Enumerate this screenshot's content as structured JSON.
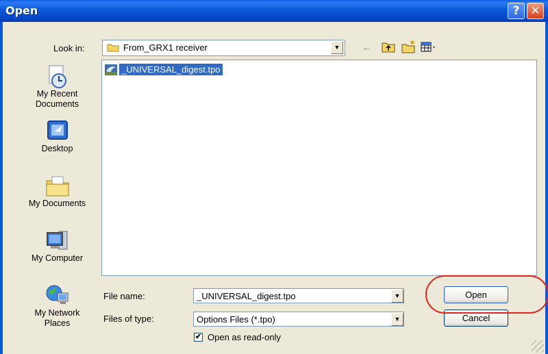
{
  "window": {
    "title": "Open",
    "help_glyph": "?",
    "close_glyph": "✕"
  },
  "toolbar": {
    "look_in_label": "Look in:",
    "look_in_value": "From_GRX1 receiver",
    "icons": [
      "back-arrow-icon",
      "up-folder-icon",
      "new-folder-icon",
      "views-menu-icon"
    ]
  },
  "places": [
    {
      "label": "My Recent Documents",
      "icon": "recent-documents-icon"
    },
    {
      "label": "Desktop",
      "icon": "desktop-icon"
    },
    {
      "label": "My Documents",
      "icon": "my-documents-icon"
    },
    {
      "label": "My Computer",
      "icon": "my-computer-icon"
    },
    {
      "label": "My Network Places",
      "icon": "network-places-icon"
    }
  ],
  "files": [
    {
      "name": "_UNIVERSAL_digest.tpo",
      "selected": true
    }
  ],
  "form": {
    "file_name_label": "File name:",
    "file_name_value": "_UNIVERSAL_digest.tpo",
    "file_type_label": "Files of type:",
    "file_type_value": "Options Files (*.tpo)",
    "readonly_label": "Open as read-only",
    "readonly_checked": true
  },
  "buttons": {
    "open": "Open",
    "cancel": "Cancel"
  },
  "colors": {
    "titlebar": "#0a58d8",
    "selection": "#316ac5",
    "annotation": "#e2231a",
    "dialog_bg": "#ece9d8"
  }
}
